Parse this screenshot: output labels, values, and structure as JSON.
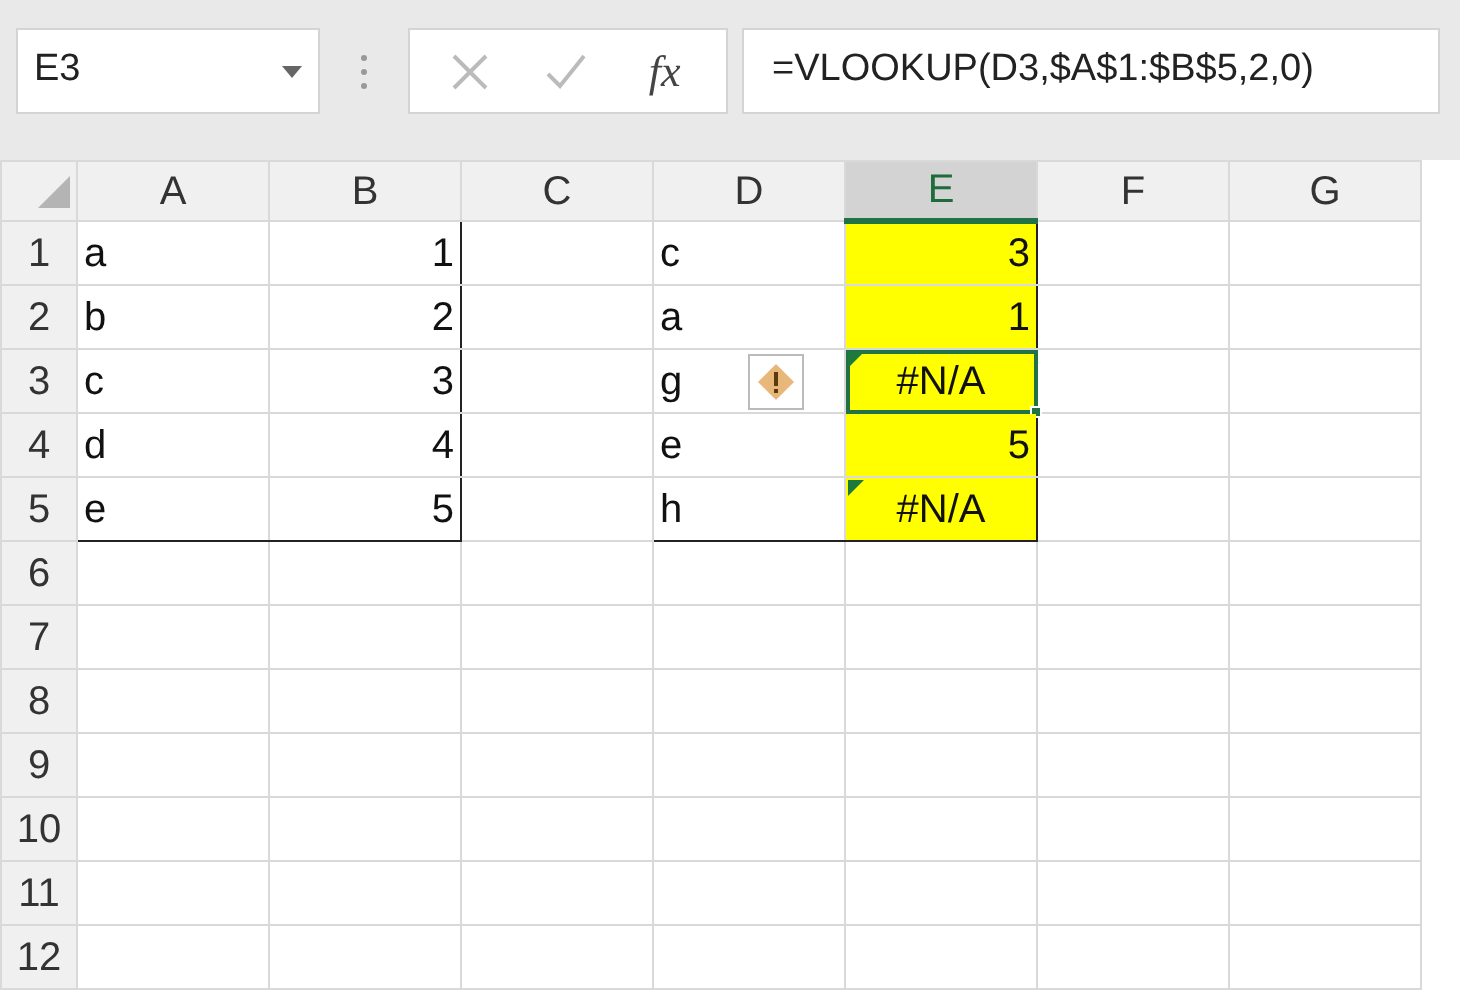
{
  "name_box": {
    "value": "E3"
  },
  "formula_bar": {
    "function_label": "fx",
    "formula": "=VLOOKUP(D3,$A$1:$B$5,2,0)"
  },
  "columns": [
    {
      "label": "A",
      "selected": false
    },
    {
      "label": "B",
      "selected": false
    },
    {
      "label": "C",
      "selected": false
    },
    {
      "label": "D",
      "selected": false
    },
    {
      "label": "E",
      "selected": true
    },
    {
      "label": "F",
      "selected": false
    },
    {
      "label": "G",
      "selected": false
    }
  ],
  "rows": [
    {
      "label": "1",
      "cells": [
        {
          "text": "a",
          "kind": "text",
          "framed": true
        },
        {
          "text": "1",
          "kind": "number",
          "framed": true
        },
        {
          "kind": "empty"
        },
        {
          "text": "c",
          "kind": "text",
          "framed": true
        },
        {
          "text": "3",
          "kind": "number",
          "framed": true,
          "highlighted": true,
          "selected": false
        }
      ]
    },
    {
      "label": "2",
      "cells": [
        {
          "text": "b",
          "kind": "text",
          "framed": true
        },
        {
          "text": "2",
          "kind": "number",
          "framed": true
        },
        {
          "kind": "empty"
        },
        {
          "text": "a",
          "kind": "text",
          "framed": true
        },
        {
          "text": "1",
          "kind": "number",
          "framed": true,
          "highlighted": true,
          "selected": false
        }
      ]
    },
    {
      "label": "3",
      "cells": [
        {
          "text": "c",
          "kind": "text",
          "framed": true
        },
        {
          "text": "3",
          "kind": "number",
          "framed": true
        },
        {
          "kind": "empty"
        },
        {
          "text": "g",
          "kind": "text",
          "framed": true,
          "smart_tag": true
        },
        {
          "text": "#N/A",
          "kind": "error",
          "framed": true,
          "highlighted": true,
          "selected": true,
          "error_flag": true
        }
      ]
    },
    {
      "label": "4",
      "cells": [
        {
          "text": "d",
          "kind": "text",
          "framed": true
        },
        {
          "text": "4",
          "kind": "number",
          "framed": true
        },
        {
          "kind": "empty"
        },
        {
          "text": "e",
          "kind": "text",
          "framed": true
        },
        {
          "text": "5",
          "kind": "number",
          "framed": true,
          "highlighted": true,
          "selected": false
        }
      ]
    },
    {
      "label": "5",
      "cells": [
        {
          "text": "e",
          "kind": "text",
          "framed": true
        },
        {
          "text": "5",
          "kind": "number",
          "framed": true
        },
        {
          "kind": "empty"
        },
        {
          "text": "h",
          "kind": "text",
          "framed": true
        },
        {
          "text": "#N/A",
          "kind": "error",
          "framed": true,
          "highlighted": true,
          "selected": false,
          "error_flag": true
        }
      ]
    },
    {
      "label": "6",
      "cells": []
    },
    {
      "label": "7",
      "cells": []
    },
    {
      "label": "8",
      "cells": []
    },
    {
      "label": "9",
      "cells": []
    },
    {
      "label": "10",
      "cells": []
    },
    {
      "label": "11",
      "cells": []
    },
    {
      "label": "12",
      "cells": []
    }
  ]
}
